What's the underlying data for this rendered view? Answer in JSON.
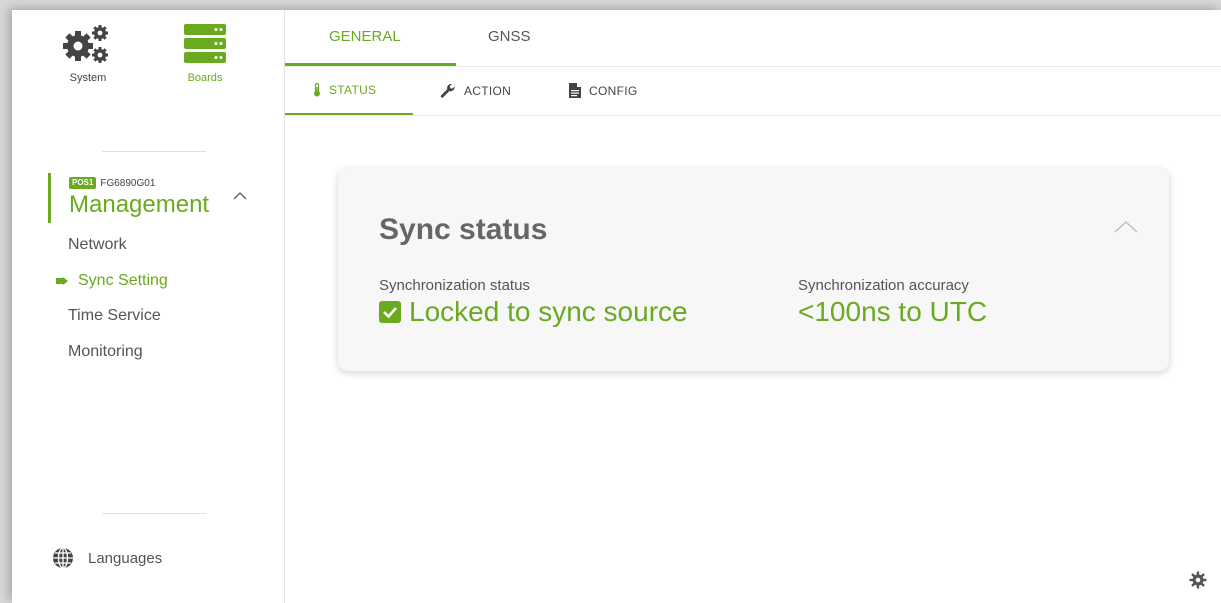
{
  "colors": {
    "accent": "#6aaa1e",
    "text": "#555555",
    "card_bg": "#f7f7f7"
  },
  "sidebar": {
    "top_icons": [
      {
        "label": "System",
        "icon": "gears-icon"
      },
      {
        "label": "Boards",
        "icon": "server-stack-icon"
      }
    ],
    "board": {
      "badge": "POS1",
      "id": "FG6890G01",
      "title": "Management"
    },
    "nav_items": [
      {
        "label": "Network",
        "active": false
      },
      {
        "label": "Sync Setting",
        "active": true
      },
      {
        "label": "Time Service",
        "active": false
      },
      {
        "label": "Monitoring",
        "active": false
      }
    ],
    "languages_label": "Languages"
  },
  "tabs_primary": [
    {
      "label": "GENERAL",
      "active": true
    },
    {
      "label": "GNSS",
      "active": false
    }
  ],
  "tabs_secondary": [
    {
      "label": "STATUS",
      "icon": "thermometer-icon",
      "active": true
    },
    {
      "label": "ACTION",
      "icon": "wrench-icon",
      "active": false
    },
    {
      "label": "CONFIG",
      "icon": "document-icon",
      "active": false
    }
  ],
  "card": {
    "title": "Sync status",
    "fields": [
      {
        "label": "Synchronization status",
        "value": "Locked to sync source",
        "checked": true
      },
      {
        "label": "Synchronization accuracy",
        "value": "<100ns to UTC"
      }
    ]
  }
}
